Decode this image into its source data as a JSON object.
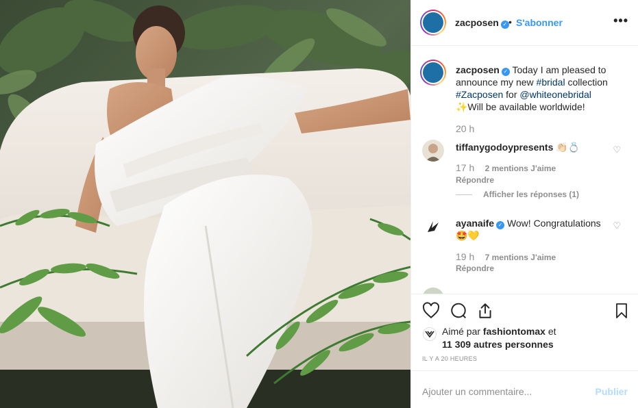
{
  "post": {
    "username": "zacposen",
    "follow_label": "S'abonner",
    "separator": "•",
    "more_label": "•••",
    "caption": {
      "part1": "Today I am pleased to announce my new ",
      "tag_bridal": "#bridal",
      "part2": " collection ",
      "tag_zacposen": "#Zacposen",
      "part3": " for ",
      "mention": "@whiteonebridal",
      "part4": "✨Will be available worldwide!",
      "time": "20 h"
    }
  },
  "comments": [
    {
      "username": "tiffanygodoypresents",
      "text": "👏🏻💍",
      "time": "17 h",
      "likes": "2 mentions J'aime",
      "reply_label": "Répondre",
      "view_replies": "Afficher les réponses (1)"
    },
    {
      "username": "ayanaife",
      "text": "Wow! Congratulations 🤩💛",
      "time": "19 h",
      "likes": "7 mentions J'aime",
      "reply_label": "Répondre"
    }
  ],
  "likes": {
    "prefix": "Aimé par ",
    "user": "fashiontomax",
    "middle": " et",
    "count": "11 309 autres personnes"
  },
  "time_ago": "IL Y A 20 HEURES",
  "add_comment": {
    "placeholder": "Ajouter un commentaire...",
    "post_label": "Publier"
  },
  "colors": {
    "link": "#00376b",
    "accent": "#3897f0",
    "muted": "#8e8e8e"
  }
}
